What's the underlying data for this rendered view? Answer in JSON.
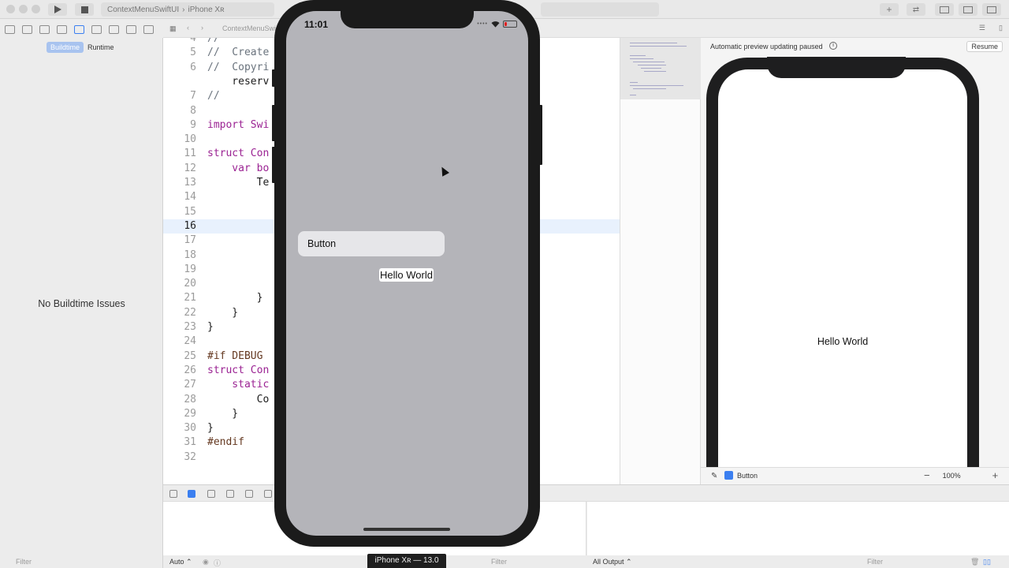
{
  "toolbar": {
    "scheme_project": "ContextMenuSwiftUI",
    "scheme_device": "iPhone Xʀ"
  },
  "navigator": {
    "tabs": [
      "Buildtime",
      "Runtime"
    ],
    "selected_tab": "Buildtime",
    "empty_message": "No Buildtime Issues",
    "filter_placeholder": "Filter"
  },
  "jump_bar": {
    "file": "ContextMenuSwi"
  },
  "editor": {
    "lines": [
      {
        "n": "4",
        "text": "//"
      },
      {
        "n": "5",
        "text": "//  Create"
      },
      {
        "n": "6",
        "text": "//  Copyri                                    ghts"
      },
      {
        "n": "",
        "text": "    reserv"
      },
      {
        "n": "7",
        "text": "//"
      },
      {
        "n": "8",
        "text": ""
      },
      {
        "n": "9",
        "text": "import Swi"
      },
      {
        "n": "10",
        "text": ""
      },
      {
        "n": "11",
        "text": "struct Con"
      },
      {
        "n": "12",
        "text": "    var bo"
      },
      {
        "n": "13",
        "text": "        Te"
      },
      {
        "n": "14",
        "text": ""
      },
      {
        "n": "15",
        "text": ""
      },
      {
        "n": "16",
        "text": ""
      },
      {
        "n": "17",
        "text": ""
      },
      {
        "n": "18",
        "text": ""
      },
      {
        "n": "19",
        "text": ""
      },
      {
        "n": "20",
        "text": ""
      },
      {
        "n": "21",
        "text": "        }"
      },
      {
        "n": "22",
        "text": "    }"
      },
      {
        "n": "23",
        "text": "}"
      },
      {
        "n": "24",
        "text": ""
      },
      {
        "n": "25",
        "text": "#if DEBUG"
      },
      {
        "n": "26",
        "text": "struct Con"
      },
      {
        "n": "27",
        "text": "    static"
      },
      {
        "n": "28",
        "text": "        Co"
      },
      {
        "n": "29",
        "text": "    }"
      },
      {
        "n": "30",
        "text": "}"
      },
      {
        "n": "31",
        "text": "#endif"
      },
      {
        "n": "32",
        "text": ""
      }
    ],
    "current_line": "16"
  },
  "canvas": {
    "header_message": "Automatic preview updating paused",
    "resume_label": "Resume",
    "preview_text": "Hello World",
    "footer_preview_name": "Button",
    "zoom_level": "100%"
  },
  "simulator": {
    "time": "11:01",
    "menu_item_label": "Button",
    "hello_text": "Hello World",
    "device_label": "iPhone Xʀ — 13.0"
  },
  "debug": {
    "auto_label": "Auto ⌃",
    "filter_placeholder": "Filter",
    "output_label": "All Output ⌃",
    "filter_placeholder_right": "Filter"
  }
}
